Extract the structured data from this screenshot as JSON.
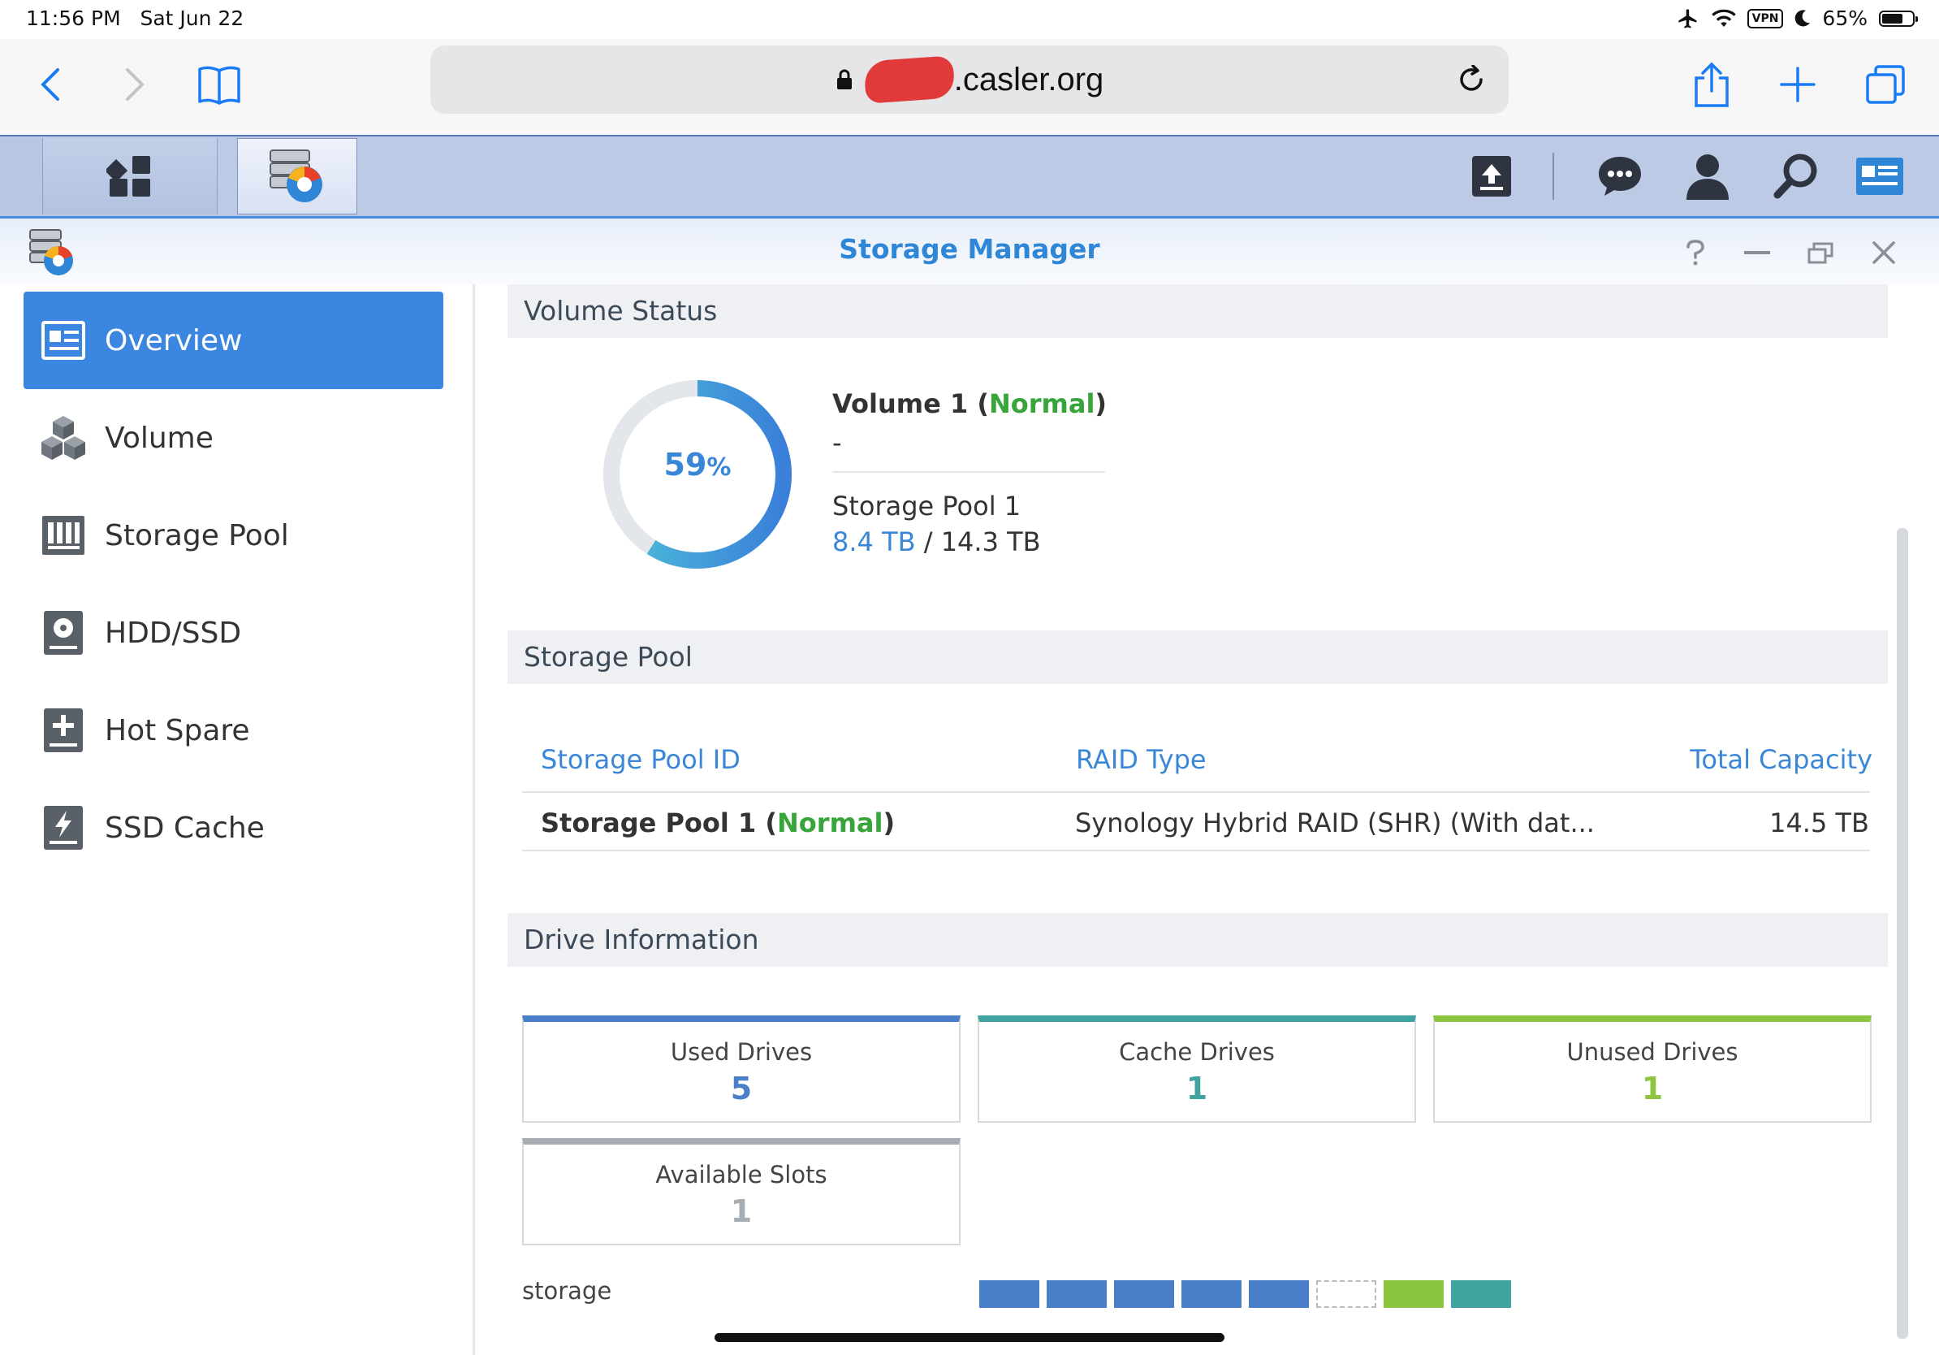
{
  "status_bar": {
    "time": "11:56 PM",
    "date": "Sat Jun 22",
    "vpn": "VPN",
    "battery": "65%"
  },
  "browser": {
    "url": ".casler.org"
  },
  "window": {
    "title": "Storage Manager"
  },
  "sidebar": {
    "items": [
      {
        "label": "Overview",
        "icon": "overview-icon",
        "active": true
      },
      {
        "label": "Volume",
        "icon": "volume-icon"
      },
      {
        "label": "Storage Pool",
        "icon": "storage-pool-icon"
      },
      {
        "label": "HDD/SSD",
        "icon": "hdd-icon"
      },
      {
        "label": "Hot Spare",
        "icon": "hot-spare-icon"
      },
      {
        "label": "SSD Cache",
        "icon": "ssd-cache-icon"
      }
    ]
  },
  "volume_status": {
    "heading": "Volume Status",
    "percent": "59",
    "percent_sign": "%",
    "usage_fraction": 0.59,
    "name": "Volume 1",
    "state": "Normal",
    "description": "-",
    "pool": "Storage Pool 1",
    "used": "8.4 TB",
    "separator": "/",
    "total": "14.3 TB"
  },
  "storage_pool": {
    "heading": "Storage Pool",
    "columns": {
      "id": "Storage Pool ID",
      "raid": "RAID Type",
      "capacity": "Total Capacity"
    },
    "rows": [
      {
        "name": "Storage Pool 1",
        "state": "Normal",
        "raid": "Synology Hybrid RAID (SHR) (With dat...",
        "capacity": "14.5 TB"
      }
    ]
  },
  "drive_information": {
    "heading": "Drive Information",
    "cards": [
      {
        "label": "Used Drives",
        "value": "5",
        "color": "#4a7fc9"
      },
      {
        "label": "Cache Drives",
        "value": "1",
        "color": "#3fa3a0"
      },
      {
        "label": "Unused Drives",
        "value": "1",
        "color": "#8cc63f"
      },
      {
        "label": "Available Slots",
        "value": "1",
        "color": "#a7adb4"
      }
    ],
    "storage_label": "storage",
    "slots": [
      "used",
      "used",
      "used",
      "used",
      "used",
      "empty",
      "unused",
      "cache"
    ]
  },
  "colors": {
    "accent": "#3b86e0",
    "normal": "#37a53a",
    "used": "#4a7fc9",
    "cache": "#3fa3a0",
    "unused": "#8cc63f"
  }
}
